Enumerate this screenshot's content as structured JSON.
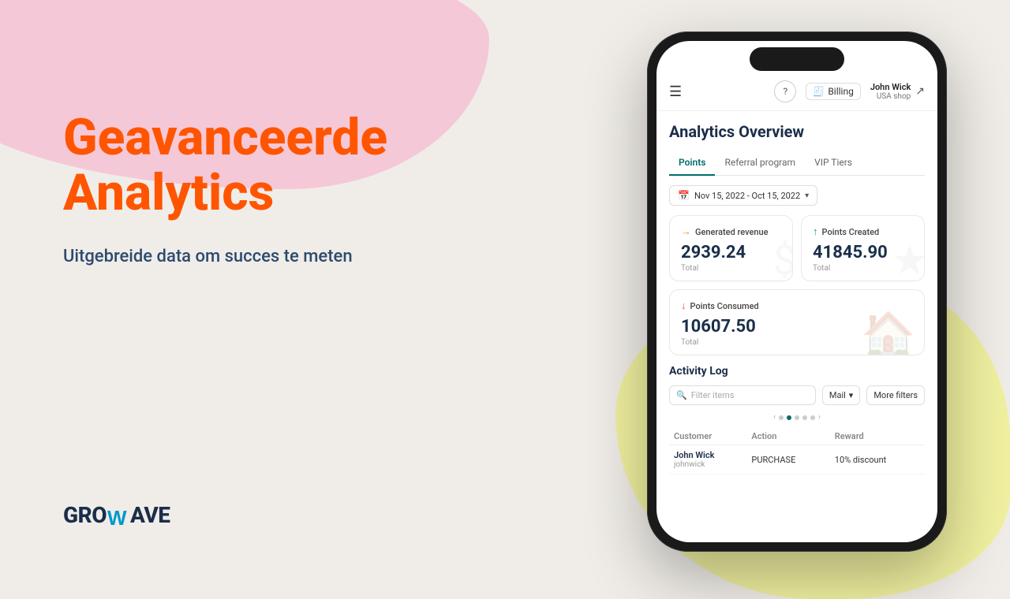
{
  "background": {
    "pink_blob": "pink",
    "yellow_blob": "yellow"
  },
  "left": {
    "main_title": "Geavanceerde Analytics",
    "subtitle": "Uitgebreide data om succes te meten",
    "logo_prefix": "GRO",
    "logo_wave": "W",
    "logo_suffix": "AVE"
  },
  "phone": {
    "header": {
      "billing_label": "Billing",
      "user_name": "John Wick",
      "user_shop": "USA shop"
    },
    "analytics": {
      "title": "Analytics Overview",
      "tabs": [
        {
          "label": "Points",
          "active": true
        },
        {
          "label": "Referral program",
          "active": false
        },
        {
          "label": "VIP Tiers",
          "active": false
        }
      ],
      "date_range": "Nov 15, 2022 - Oct 15, 2022",
      "metrics": [
        {
          "id": "generated-revenue",
          "label": "Generated revenue",
          "value": "2939.24",
          "total_label": "Total",
          "icon_type": "arrow-right"
        },
        {
          "id": "points-created",
          "label": "Points Created",
          "value": "41845.90",
          "total_label": "Total",
          "icon_type": "arrow-up"
        }
      ],
      "metric_consumed": {
        "label": "Points Consumed",
        "value": "10607.50",
        "total_label": "Total",
        "icon_type": "arrow-down"
      },
      "activity_log": {
        "title": "Activity Log",
        "search_placeholder": "Filter items",
        "filter_mail_label": "Mail",
        "filter_more_label": "More filters",
        "table_headers": [
          "Customer",
          "Action",
          "Reward"
        ],
        "rows": [
          {
            "customer_name": "John Wick",
            "customer_id": "johnwick",
            "action": "PURCHASE",
            "reward": "10% discount"
          }
        ]
      }
    }
  }
}
